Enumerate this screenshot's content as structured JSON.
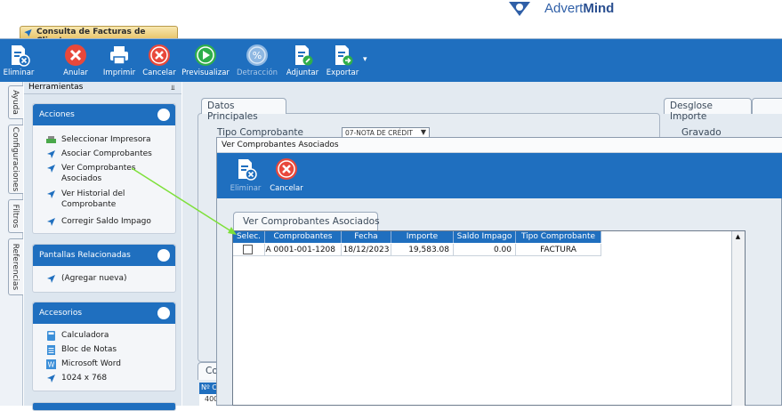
{
  "brand": {
    "logo_text_light": "Advert",
    "logo_text_bold": "Mind",
    "color": "#2f5fa7"
  },
  "window": {
    "title": "Consulta de Facturas de Clientes"
  },
  "toolbar": {
    "buttons": [
      {
        "label": "Eliminar",
        "icon": "delete-doc-icon"
      },
      {
        "label": "Anular",
        "icon": "x-circle-icon"
      },
      {
        "label": "Imprimir",
        "icon": "printer-icon"
      },
      {
        "label": "Cancelar",
        "icon": "x-circle-icon"
      },
      {
        "label": "Previsualizar",
        "icon": "play-icon"
      },
      {
        "label": "Detracción",
        "icon": "percent-icon",
        "disabled": true
      },
      {
        "label": "Adjuntar",
        "icon": "attach-doc-icon"
      },
      {
        "label": "Exportar",
        "icon": "export-doc-icon"
      }
    ],
    "color": "#1f6fbf"
  },
  "side_tabs": [
    "Ayuda",
    "Configuraciones",
    "Filtros",
    "Referencias"
  ],
  "tools": {
    "header": "Herramientas",
    "sections": [
      {
        "title": "Acciones",
        "items": [
          {
            "label": "Seleccionar Impresora",
            "icon": "printer-small-icon"
          },
          {
            "label": "Asociar Comprobantes",
            "icon": "pointer-icon"
          },
          {
            "label": "Ver Comprobantes Asociados",
            "line1": "Ver Comprobantes",
            "line2": "Asociados",
            "icon": "pointer-icon"
          },
          {
            "label": "Ver Historial del Comprobante",
            "line1": "Ver Historial del",
            "line2": "Comprobante",
            "icon": "pointer-icon"
          },
          {
            "label": "Corregir Saldo Impago",
            "icon": "pointer-icon"
          }
        ]
      },
      {
        "title": "Pantallas Relacionadas",
        "items": [
          {
            "label": "(Agregar nueva)",
            "icon": "pointer-icon"
          }
        ]
      },
      {
        "title": "Accesorios",
        "items": [
          {
            "label": "Calculadora",
            "icon": "calculator-icon"
          },
          {
            "label": "Bloc de Notas",
            "icon": "notepad-icon"
          },
          {
            "label": "Microsoft Word",
            "icon": "word-icon"
          },
          {
            "label": "1024 x 768",
            "icon": "pointer-icon"
          }
        ]
      }
    ]
  },
  "main": {
    "datos_tab": "Datos Principales",
    "tipo_label": "Tipo Comprobante",
    "tipo_value": "07-NOTA DE CRÉDIT",
    "desglose_tab": "Desglose Importe",
    "gravado_label": "Gravado",
    "bottom_tab": "Co",
    "bottom_grid_header": "Nº C",
    "bottom_grid_value": "400"
  },
  "modal": {
    "title": "Ver Comprobantes Asociados",
    "toolbar": [
      {
        "label": "Eliminar",
        "icon": "delete-doc-icon",
        "disabled": true
      },
      {
        "label": "Cancelar",
        "icon": "x-circle-icon"
      }
    ],
    "tab": "Ver Comprobantes Asociados",
    "columns": [
      "Selec.",
      "Comprobantes",
      "Fecha",
      "Importe",
      "Saldo Impago",
      "Tipo Comprobante"
    ],
    "rows": [
      {
        "selected": false,
        "comprobante": "A 0001-001-1208",
        "fecha": "18/12/2023",
        "importe": "19,583.08",
        "saldo": "0.00",
        "tipo": "FACTURA"
      }
    ]
  },
  "colors": {
    "accent": "#1f6fbf",
    "danger": "#e8483b",
    "success": "#2fae4b",
    "annotation_arrow": "#7ee03a"
  }
}
